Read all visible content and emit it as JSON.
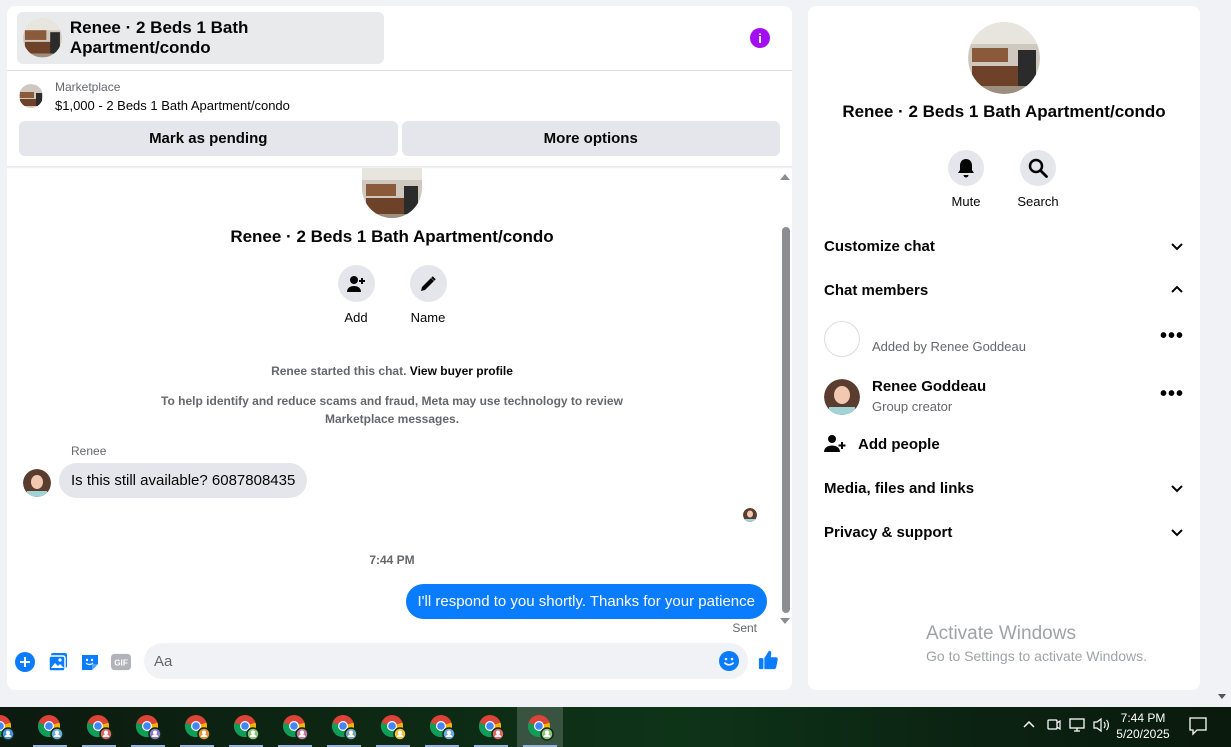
{
  "header": {
    "title": "Renee · 2 Beds 1 Bath Apartment/condo"
  },
  "marketplace": {
    "label": "Marketplace",
    "listing": "$1,000 - 2 Beds 1 Bath Apartment/condo",
    "mark_pending": "Mark as pending",
    "more_options": "More options"
  },
  "conversation": {
    "group_name": "Renee · 2 Beds 1 Bath Apartment/condo",
    "actions": [
      {
        "label": "Add",
        "icon": "add-person-icon"
      },
      {
        "label": "Name",
        "icon": "pencil-icon"
      }
    ],
    "started_text": "Renee started this chat.",
    "buyer_profile_link": "View buyer profile",
    "fraud_notice": "To help identify and reduce scams and fraud, Meta may use technology to review Marketplace messages.",
    "messages": [
      {
        "sender": "Renee",
        "text": "Is this still available? 6087808435",
        "direction": "incoming"
      },
      {
        "timestamp": "7:44 PM"
      },
      {
        "text": "I'll respond to you shortly. Thanks for your patience",
        "direction": "outgoing",
        "status": "Sent"
      }
    ]
  },
  "composer": {
    "placeholder": "Aa",
    "icons": [
      "plus-icon",
      "photo-icon",
      "sticker-icon",
      "gif-icon",
      "emoji-icon",
      "thumbs-up-icon"
    ],
    "gif_label": "GIF"
  },
  "side_panel": {
    "name": "Renee · 2 Beds 1 Bath Apartment/condo",
    "actions": [
      {
        "label": "Mute",
        "icon": "bell-icon"
      },
      {
        "label": "Search",
        "icon": "search-icon"
      }
    ],
    "sections": {
      "customize": "Customize chat",
      "members": "Chat members",
      "media": "Media, files and links",
      "privacy": "Privacy & support"
    },
    "members": [
      {
        "name": "",
        "sub": "Added by Renee Goddeau"
      },
      {
        "name": "Renee Goddeau",
        "sub": "Group creator"
      }
    ],
    "add_people": "Add people"
  },
  "watermark": {
    "title": "Activate Windows",
    "subtitle": "Go to Settings to activate Windows."
  },
  "taskbar": {
    "app_count": 12,
    "time": "7:44 PM",
    "date": "5/20/2025"
  },
  "colors": {
    "accent": "#0a7cff",
    "info": "#a20ff0",
    "bubble_in": "#e4e6eb"
  }
}
